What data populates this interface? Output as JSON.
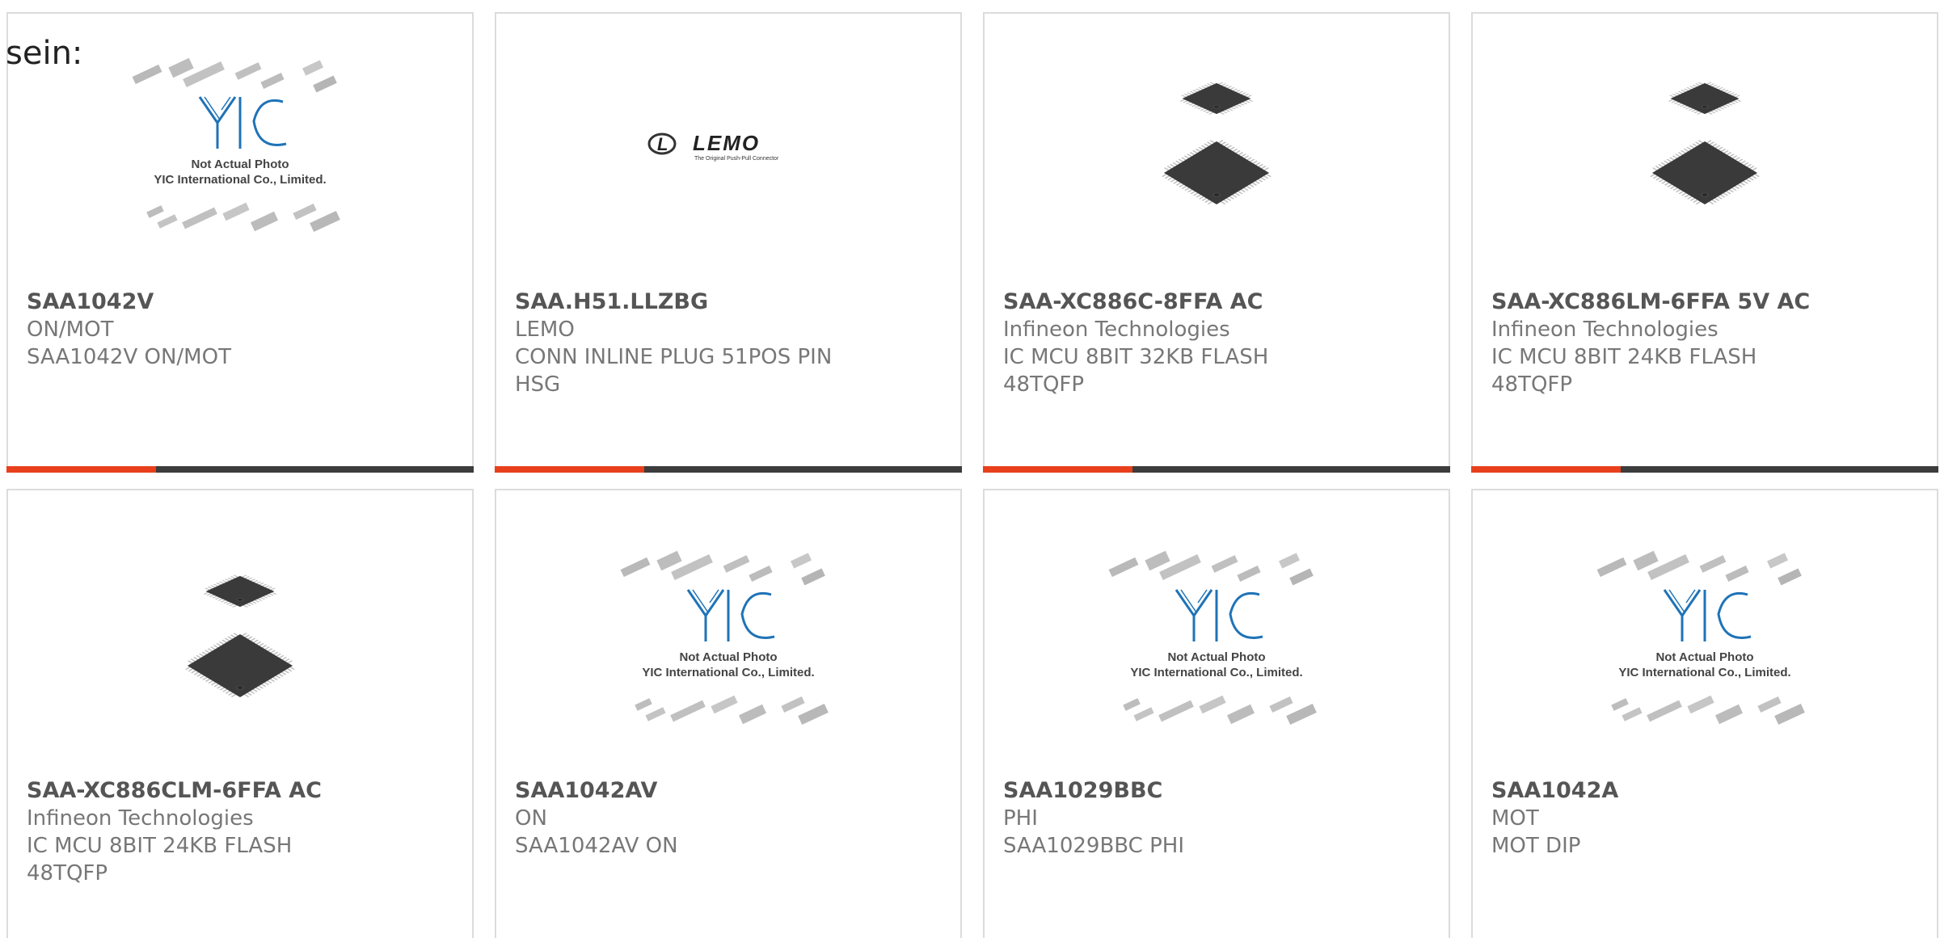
{
  "page": {
    "heading_fragment": "sein:"
  },
  "colors": {
    "accent": "#e8401c",
    "bar_track": "#3c3c3c",
    "border": "#dcdcdc",
    "text": "#777777",
    "title": "#555555",
    "yic_blue": "#1f73b7"
  },
  "placeholder": {
    "line1": "Not Actual Photo",
    "line2": "YIC International Co., Limited."
  },
  "lemo_logo": {
    "brand": "LEMO",
    "tagline": "The Original Push-Pull Connector"
  },
  "products": [
    {
      "part_number": "SAA1042V",
      "maker": "ON/MOT",
      "desc_lines": [
        "SAA1042V ON/MOT",
        ""
      ],
      "image": "not-actual-photo",
      "progress": 0.32
    },
    {
      "part_number": "SAA.H51.LLZBG",
      "maker": "LEMO",
      "desc_lines": [
        "CONN INLINE PLUG 51POS PIN",
        "HSG"
      ],
      "image": "lemo-logo",
      "progress": 0.32
    },
    {
      "part_number": "SAA-XC886C-8FFA AC",
      "maker": "Infineon Technologies",
      "desc_lines": [
        "IC MCU 8BIT 32KB FLASH",
        "48TQFP"
      ],
      "image": "tqfp-chip",
      "progress": 0.32
    },
    {
      "part_number": "SAA-XC886LM-6FFA 5V AC",
      "maker": "Infineon Technologies",
      "desc_lines": [
        "IC MCU 8BIT 24KB FLASH",
        "48TQFP"
      ],
      "image": "tqfp-chip",
      "progress": 0.32
    },
    {
      "part_number": "SAA-XC886CLM-6FFA AC",
      "maker": "Infineon Technologies",
      "desc_lines": [
        "IC MCU 8BIT 24KB FLASH",
        "48TQFP"
      ],
      "image": "tqfp-chip",
      "progress": 0
    },
    {
      "part_number": "SAA1042AV",
      "maker": "ON",
      "desc_lines": [
        "SAA1042AV ON",
        ""
      ],
      "image": "not-actual-photo",
      "progress": 0
    },
    {
      "part_number": "SAA1029BBC",
      "maker": "PHI",
      "desc_lines": [
        "SAA1029BBC PHI",
        ""
      ],
      "image": "not-actual-photo",
      "progress": 0
    },
    {
      "part_number": "SAA1042A",
      "maker": "MOT",
      "desc_lines": [
        "MOT DIP",
        ""
      ],
      "image": "not-actual-photo",
      "progress": 0
    }
  ]
}
